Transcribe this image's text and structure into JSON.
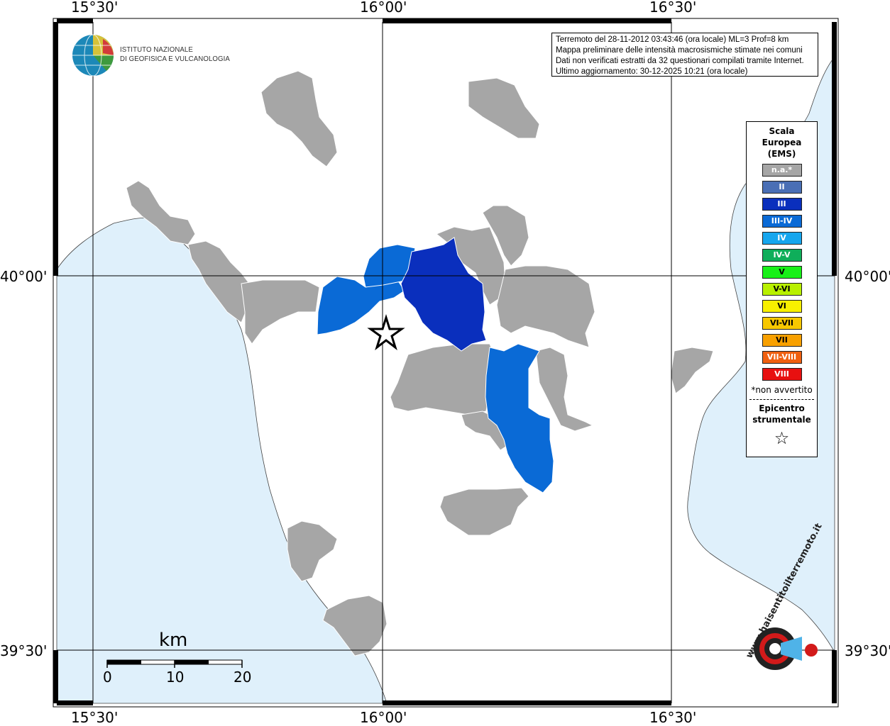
{
  "map": {
    "lon_labels": [
      "15°30'",
      "16°00'",
      "16°30'"
    ],
    "lat_labels": [
      "40°00'",
      "39°30'"
    ],
    "epicenter_symbol": "star-icon",
    "colors": {
      "sea": "#dff0fb",
      "land": "#ffffff",
      "na": "#a6a6a6",
      "grid": "#000000"
    }
  },
  "info": {
    "lines": [
      "Terremoto del 28-11-2012 03:43:46 (ora locale) ML=3 Prof=8 km",
      "Mappa preliminare delle intensità macrosismiche stimate nei comuni",
      "Dati non verificati estratti da 32 questionari compilati tramite Internet.",
      "Ultimo aggiornamento: 30-12-2025 10:21 (ora locale)"
    ]
  },
  "logo": {
    "line1": "ISTITUTO NAZIONALE",
    "line2": "DI GEOFISICA E VULCANOLOGIA"
  },
  "legend": {
    "title_lines": [
      "Scala",
      "Europea",
      "(EMS)"
    ],
    "items": [
      {
        "label": "n.a.*",
        "color": "#a6a6a6",
        "text": "#ffffff"
      },
      {
        "label": "II",
        "color": "#4a6fb5",
        "text": "#ffffff"
      },
      {
        "label": "III",
        "color": "#0a2fbd",
        "text": "#ffffff"
      },
      {
        "label": "III-IV",
        "color": "#0a6ad6",
        "text": "#ffffff"
      },
      {
        "label": "IV",
        "color": "#16a6ee",
        "text": "#ffffff"
      },
      {
        "label": "IV-V",
        "color": "#0fae5a",
        "text": "#ffffff"
      },
      {
        "label": "V",
        "color": "#18f018",
        "text": "#000000"
      },
      {
        "label": "V-VI",
        "color": "#b8f000",
        "text": "#000000"
      },
      {
        "label": "VI",
        "color": "#f8f000",
        "text": "#000000"
      },
      {
        "label": "VI-VII",
        "color": "#f8c800",
        "text": "#000000"
      },
      {
        "label": "VII",
        "color": "#f8a000",
        "text": "#000000"
      },
      {
        "label": "VII-VIII",
        "color": "#f06010",
        "text": "#ffffff"
      },
      {
        "label": "VIII",
        "color": "#e81010",
        "text": "#ffffff"
      }
    ],
    "note": "*non avvertito",
    "epicenter_lines": [
      "Epicentro",
      "strumentale"
    ],
    "star": "☆"
  },
  "scale_bar": {
    "unit": "km",
    "ticks": [
      "0",
      "10",
      "20"
    ]
  },
  "badge": {
    "text": "www.haisentitoilterremoto.it"
  }
}
